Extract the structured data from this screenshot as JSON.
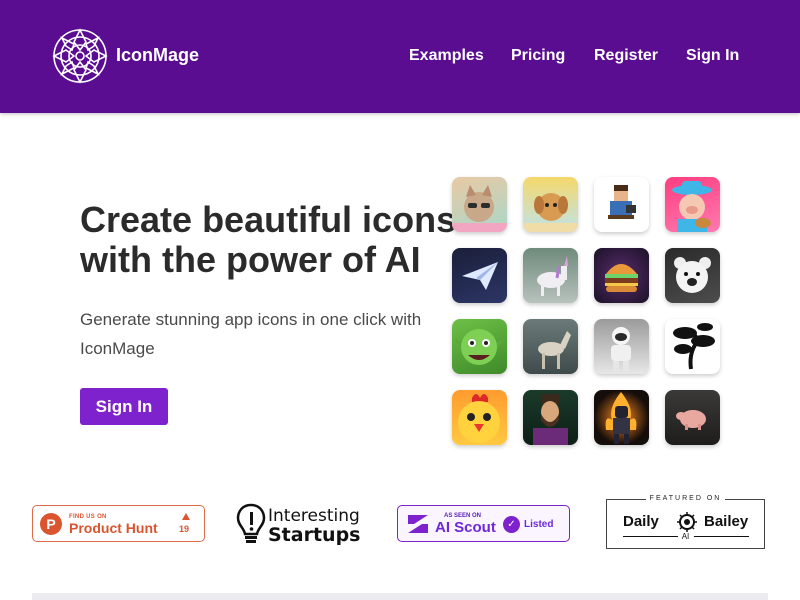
{
  "header": {
    "brand": "IconMage",
    "nav": [
      "Examples",
      "Pricing",
      "Register",
      "Sign In"
    ],
    "bg_color": "#5b0d91"
  },
  "hero": {
    "title_line1": "Create beautiful icons",
    "title_line2": "with the power of AI",
    "subtitle_line1": "Generate stunning app icons in one click with",
    "subtitle_line2": "IconMage",
    "cta_label": "Sign In",
    "cta_color": "#7e22ce"
  },
  "icons": [
    "cat-sunglasses-icon",
    "dog-beach-icon",
    "pixel-man-icon",
    "cowboy-pig-icon",
    "paper-plane-icon",
    "unicorn-icon",
    "burger-icon",
    "polar-bear-icon",
    "goblin-icon",
    "horse-icon",
    "astronaut-icon",
    "bonsai-tree-icon",
    "chicken-icon",
    "lincoln-portrait-icon",
    "fire-robot-icon",
    "pig-icon"
  ],
  "badges": {
    "product_hunt": {
      "small": "FIND US ON",
      "big": "Product Hunt",
      "votes": "19"
    },
    "interesting_startups": {
      "line1": "Interesting",
      "line2": "Startups"
    },
    "ai_scout": {
      "small": "AS SEEN ON",
      "big": "AI Scout",
      "status": "Listed"
    },
    "daily_bailey": {
      "featured": "FEATURED ON",
      "name_left": "Daily",
      "name_right": "Bailey",
      "sub": "AI"
    }
  }
}
